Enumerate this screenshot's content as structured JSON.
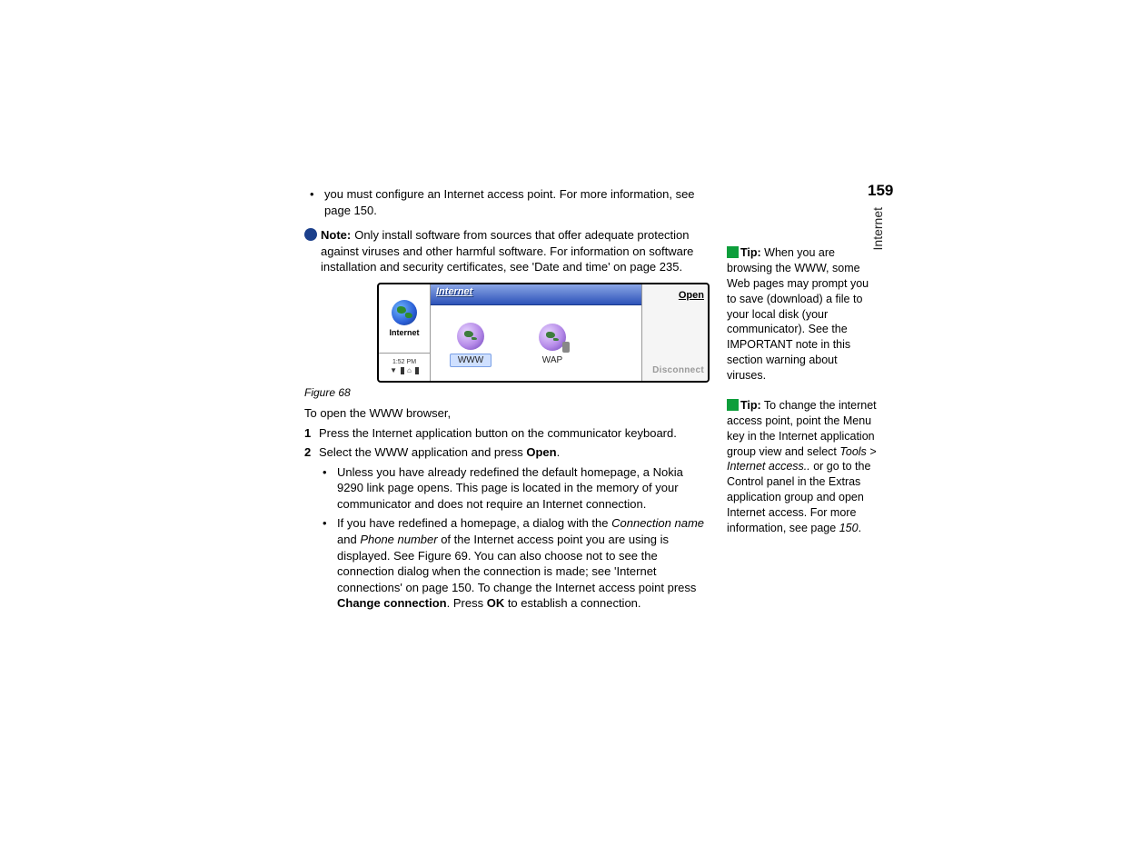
{
  "page_number": "159",
  "side_tab": "Internet",
  "main": {
    "bullet1": "you must configure an Internet access point. For more information, see page 150.",
    "note_label": "Note:",
    "note_text": "Only install software from sources that offer adequate protection against viruses and other harmful software. For information on software installation and security certificates, see 'Date and time' on page 235.",
    "figure_caption": "Figure 68",
    "intro": "To open the WWW browser,",
    "step1": "Press the Internet application button on the communicator keyboard.",
    "step2_pre": "Select the WWW application  and press ",
    "step2_bold": "Open",
    "step2_post": ".",
    "sub1": "Unless you have already redefined the default homepage, a Nokia 9290 link page opens. This page is located in the memory of your communicator and does not require an Internet connection.",
    "sub2_a": "If you have redefined a homepage, a dialog with the ",
    "sub2_i1": "Connection name",
    "sub2_b": " and ",
    "sub2_i2": "Phone number",
    "sub2_c": " of the Internet access point you are using is displayed. See Figure 69. You can also choose not to see the connection dialog when the connection is made; see 'Internet connections' on page 150. To change the Internet access point press ",
    "sub2_bold1": "Change connection",
    "sub2_d": ". Press ",
    "sub2_bold2": "OK",
    "sub2_e": " to establish a connection."
  },
  "device": {
    "left_label": "Internet",
    "clock": "1:52 PM",
    "title": "Internet",
    "app1": "WWW",
    "app2": "WAP",
    "btn_open": "Open",
    "btn_disconnect": "Disconnect"
  },
  "tips": {
    "label": "Tip:",
    "tip1": " When you are browsing the WWW, some Web pages may prompt you to save (download) a file to your local disk (your communicator). See the IMPORTANT note in this section warning about viruses.",
    "tip2_a": " To change the internet access point, point the Menu key in the Internet application group view and select ",
    "tip2_i": "Tools > Internet access..",
    "tip2_b": " or go to the Control panel in the Extras application group and open Internet access. For more information, see page ",
    "tip2_i2": "150",
    "tip2_c": "."
  }
}
